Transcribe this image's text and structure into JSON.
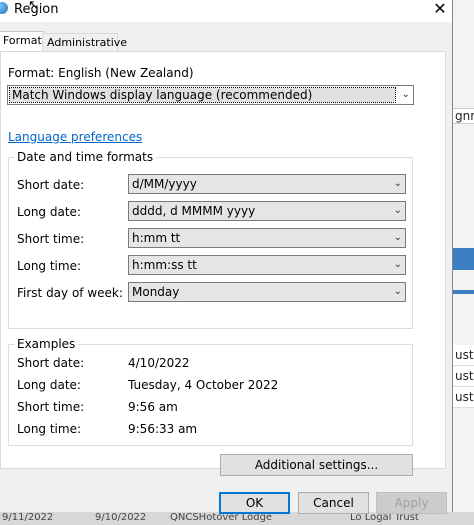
{
  "window": {
    "title": "Region",
    "close_glyph": "✕"
  },
  "tabs": [
    {
      "label": "Formats",
      "active": true
    },
    {
      "label": "Administrative",
      "active": false
    }
  ],
  "format": {
    "label": "Format: English (New Zealand)",
    "selected": "Match Windows display language (recommended)"
  },
  "language_preferences_link": "Language preferences",
  "date_time_formats": {
    "title": "Date and time formats",
    "rows": [
      {
        "label": "Short date:",
        "value": "d/MM/yyyy"
      },
      {
        "label": "Long date:",
        "value": "dddd, d MMMM yyyy"
      },
      {
        "label": "Short time:",
        "value": "h:mm tt"
      },
      {
        "label": "Long time:",
        "value": "h:mm:ss tt"
      },
      {
        "label": "First day of week:",
        "value": "Monday"
      }
    ]
  },
  "examples": {
    "title": "Examples",
    "rows": [
      {
        "label": "Short date:",
        "value": "4/10/2022"
      },
      {
        "label": "Long date:",
        "value": "Tuesday, 4 October 2022"
      },
      {
        "label": "Short time:",
        "value": "9:56 am"
      },
      {
        "label": "Long time:",
        "value": "9:56:33 am"
      }
    ]
  },
  "buttons": {
    "additional_settings": "Additional settings...",
    "ok": "OK",
    "cancel": "Cancel",
    "apply": "Apply"
  },
  "background_app": {
    "right_text": [
      "gnm",
      "ust",
      "ust",
      "ust"
    ],
    "bottom_text": [
      "9/11/2022",
      "9/10/2022",
      "QNCSHotover Lodge",
      "Lo Logal Trust"
    ]
  },
  "colors": {
    "link": "#0066cc",
    "accent": "#0078d7"
  }
}
